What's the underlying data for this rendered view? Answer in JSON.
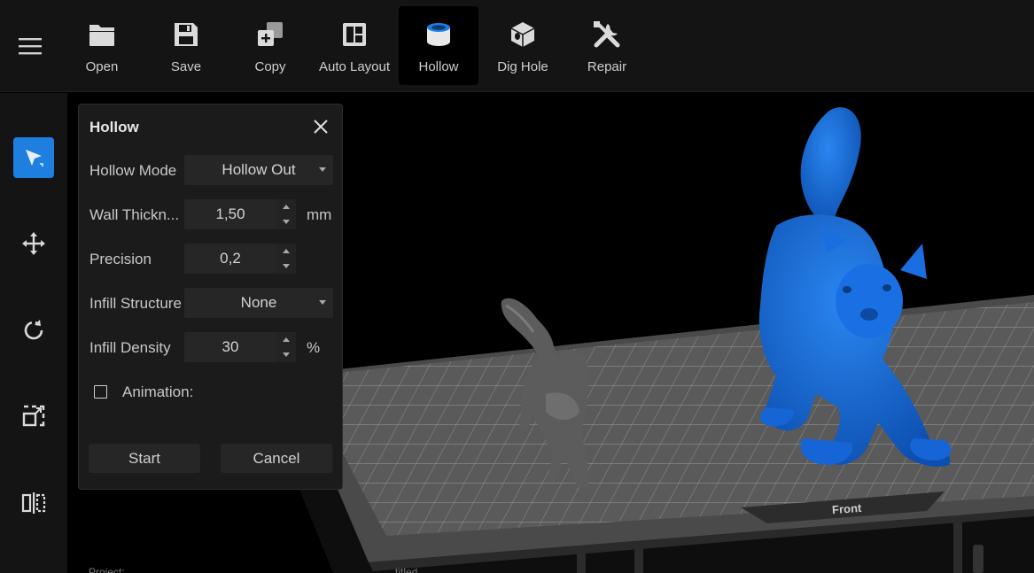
{
  "toolbar": {
    "tools": [
      {
        "label": "Open",
        "icon": "folder-icon"
      },
      {
        "label": "Save",
        "icon": "save-icon"
      },
      {
        "label": "Copy",
        "icon": "copy-icon"
      },
      {
        "label": "Auto Layout",
        "icon": "auto-layout-icon"
      },
      {
        "label": "Hollow",
        "icon": "hollow-icon",
        "active": true
      },
      {
        "label": "Dig Hole",
        "icon": "dig-hole-icon"
      },
      {
        "label": "Repair",
        "icon": "repair-icon"
      }
    ]
  },
  "sidebar": {
    "tools": [
      {
        "icon": "select-arrow-icon",
        "active": true
      },
      {
        "icon": "move-icon"
      },
      {
        "icon": "rotate-icon"
      },
      {
        "icon": "scale-icon"
      },
      {
        "icon": "mirror-icon"
      }
    ]
  },
  "panel": {
    "title": "Hollow",
    "hollow_mode": {
      "label": "Hollow Mode",
      "value": "Hollow Out"
    },
    "wall_thickness": {
      "label": "Wall Thickn...",
      "value": "1,50",
      "unit": "mm"
    },
    "precision": {
      "label": "Precision",
      "value": "0,2"
    },
    "infill_structure": {
      "label": "Infill Structure",
      "value": "None"
    },
    "infill_density": {
      "label": "Infill Density",
      "value": "30",
      "unit": "%"
    },
    "animation": {
      "label": "Animation:",
      "checked": false
    },
    "start_label": "Start",
    "cancel_label": "Cancel"
  },
  "viewport": {
    "plate_label": "Front",
    "footer_left": "Project:",
    "footer_right": "...titled"
  },
  "colors": {
    "accent": "#1e7fe0",
    "selected_model": "#1565d6",
    "model": "#5c5c5c",
    "plate": "#6a6a6a"
  }
}
